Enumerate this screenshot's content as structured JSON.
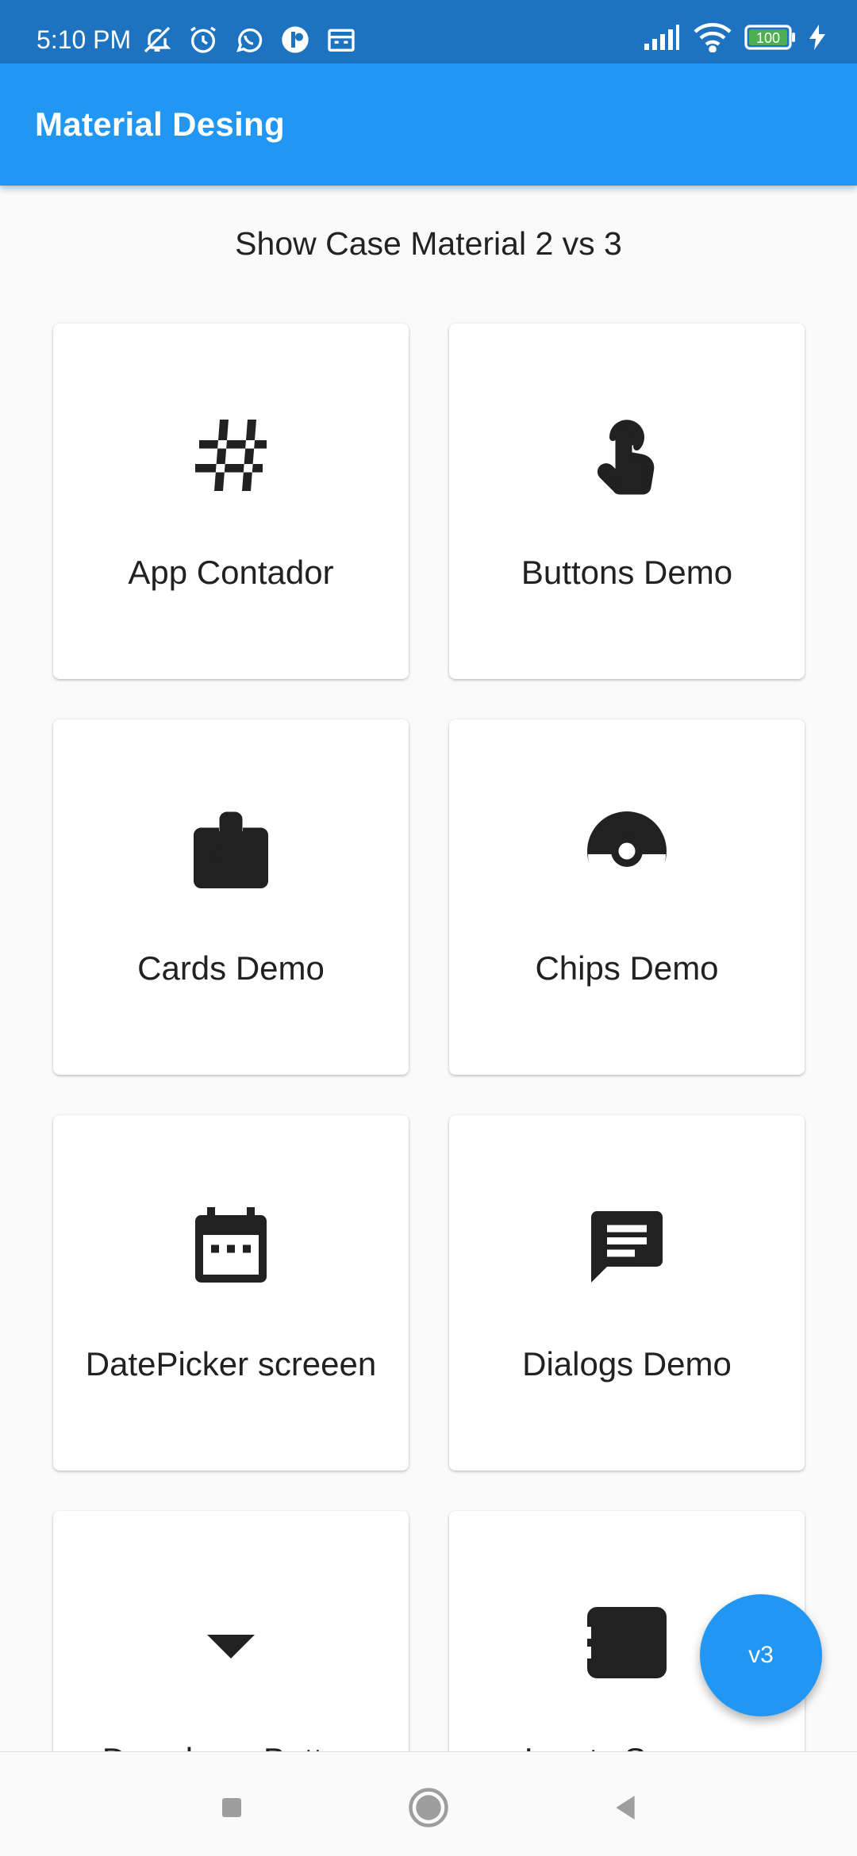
{
  "status_bar": {
    "time": "5:10 PM",
    "left_icons": [
      "mute-icon",
      "alarm-icon",
      "whatsapp-icon",
      "app-icon",
      "calendar-icon"
    ],
    "right_icons": [
      "signal-icon",
      "wifi-icon",
      "battery-icon",
      "charging-icon"
    ],
    "battery_level": "100"
  },
  "app_bar": {
    "title": "Material Desing"
  },
  "main": {
    "section_title": "Show Case Material 2 vs 3",
    "cards": [
      {
        "label": "App Contador",
        "icon": "hash-icon"
      },
      {
        "label": "Buttons Demo",
        "icon": "touch-icon"
      },
      {
        "label": "Cards Demo",
        "icon": "badge-icon"
      },
      {
        "label": "Chips Demo",
        "icon": "pokeball-icon"
      },
      {
        "label": "DatePicker screeen",
        "icon": "calendar-icon"
      },
      {
        "label": "Dialogs Demo",
        "icon": "message-icon"
      },
      {
        "label": "Dropdown Button",
        "icon": "dropdown-arrow-icon"
      },
      {
        "label": "Inputs Screen",
        "icon": "input-icon"
      }
    ]
  },
  "fab": {
    "label": "v3"
  },
  "nav": {
    "icons": [
      "recents-icon",
      "home-icon",
      "back-icon"
    ]
  },
  "colors": {
    "primary": "#2196f3",
    "status_bar": "#1e73c1",
    "background": "#fafafa",
    "card": "#ffffff",
    "text": "#212121"
  }
}
